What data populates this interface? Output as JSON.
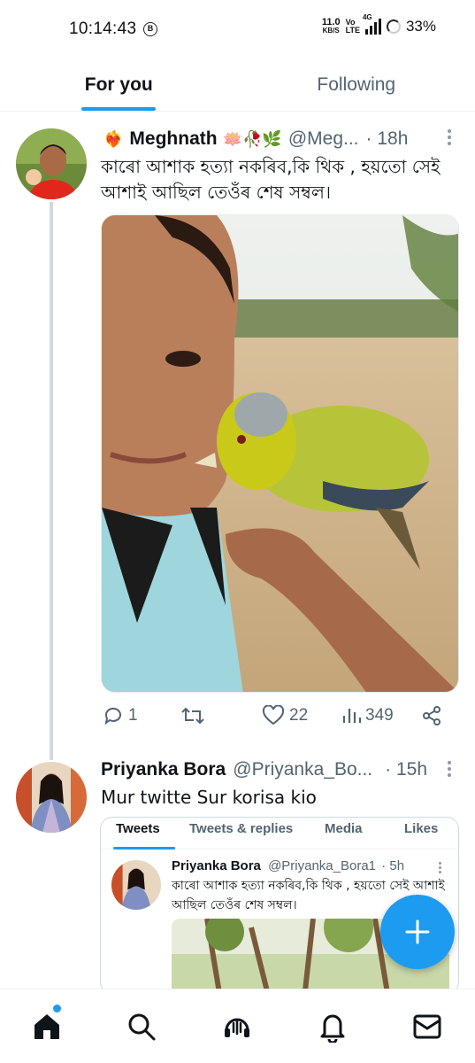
{
  "status_bar": {
    "time": "10:14:43",
    "b_icon": "B",
    "net_speed_value": "11.0",
    "net_speed_unit": "KB/S",
    "volte_top": "Vo",
    "volte_bottom": "LTE",
    "network": "4G",
    "battery": "33%"
  },
  "tabs": [
    {
      "label": "For you",
      "active": true
    },
    {
      "label": "Following",
      "active": false
    }
  ],
  "tweets": [
    {
      "name": "Meghnath",
      "emoji_prefix": "❤️‍🔥",
      "emoji_suffix": "🪷🥀🌿",
      "handle": "@Meg...",
      "time": "· 18h",
      "text": "কাৰো আশাক হত্যা নকৰিব,কি থিক , হয়তো সেই আশাই আছিল তেওঁৰ শেষ সম্বল।",
      "image_icon": "selfie-with-bird-photo",
      "actions": {
        "reply_count": "1",
        "retweet_count": "",
        "like_count": "22",
        "view_count": "349"
      }
    },
    {
      "name": "Priyanka Bora",
      "handle": "@Priyanka_Bo...",
      "time": "· 15h",
      "text": "Mur twitte Sur korisa kio",
      "embedded_card": {
        "tabs": [
          "Tweets",
          "Tweets & replies",
          "Media",
          "Likes"
        ],
        "active_tab": "Tweets",
        "inner_name": "Priyanka Bora",
        "inner_handle": "@Priyanka_Bora1",
        "inner_time": "· 5h",
        "inner_text": "কাৰো আশাক হত্যা নকৰিব,কি থিক , হয়তো সেই আশাই আছিল তেওঁৰ শেষ সম্বল।"
      }
    }
  ],
  "fab_icon": "plus-icon",
  "bottom_nav": [
    "home-icon",
    "search-icon",
    "spaces-icon",
    "notifications-icon",
    "messages-icon"
  ],
  "colors": {
    "accent": "#1d9bf0",
    "text": "#0f1419",
    "muted": "#536471"
  }
}
